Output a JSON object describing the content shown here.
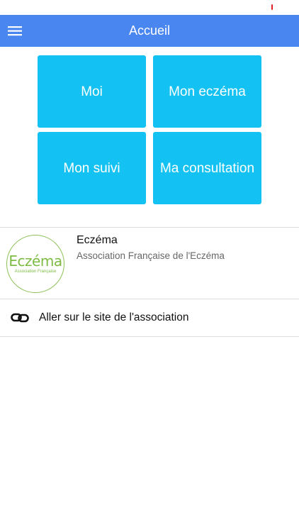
{
  "header": {
    "title": "Accueil",
    "menu_icon": "hamburger-menu-icon",
    "background_color": "#4a86f0"
  },
  "tiles": [
    {
      "label": "Moi"
    },
    {
      "label": "Mon eczéma"
    },
    {
      "label": "Mon suivi"
    },
    {
      "label": "Ma consultation"
    }
  ],
  "tile_color": "#13c2f2",
  "association": {
    "name": "Eczéma",
    "description": "Association Française de l'Eczéma",
    "logo_word": "Eczéma",
    "logo_subtitle": "Association Française",
    "logo_color": "#7dbb45"
  },
  "site_link": {
    "icon": "link-chain-icon",
    "label": "Aller sur le site de l'association"
  }
}
